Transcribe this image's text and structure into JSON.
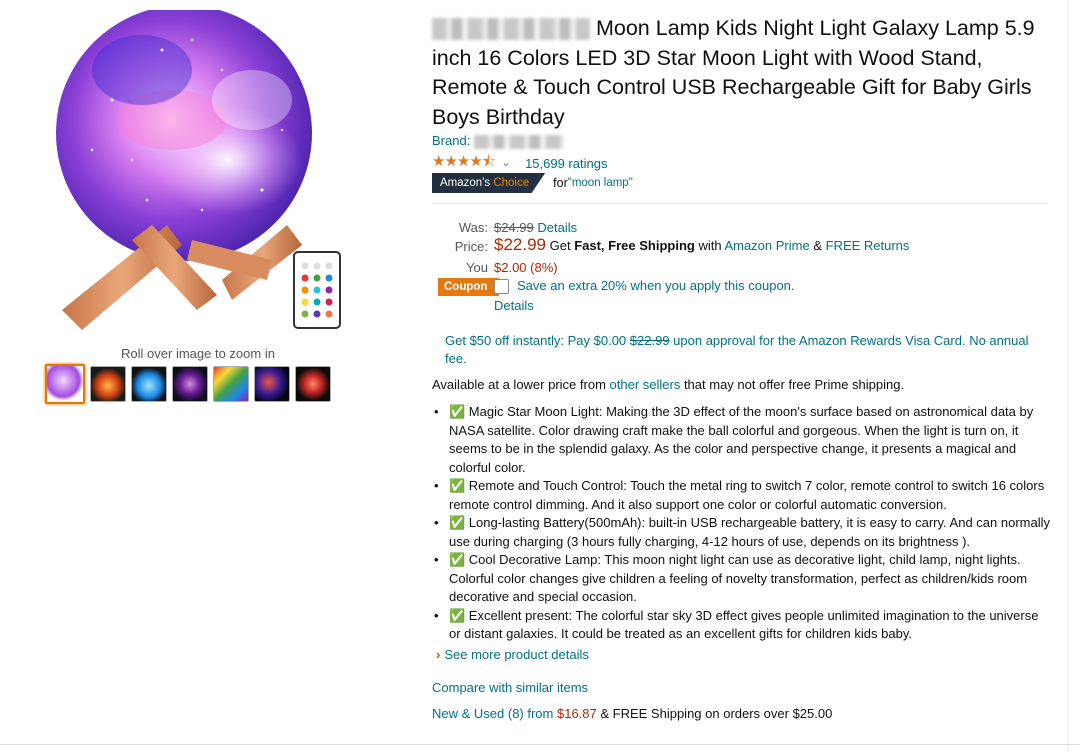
{
  "gallery": {
    "zoom_hint": "Roll over image to zoom in",
    "thumbnails": [
      "moon-lamp-thumb",
      "planets-thumb",
      "moon-blue-thumb",
      "touch-thumb",
      "colors-thumb",
      "galaxy-thumb",
      "lamp-dark-thumb"
    ]
  },
  "title": {
    "text": "Moon Lamp Kids Night Light Galaxy Lamp 5.9 inch 16 Colors LED 3D Star Moon Light with Wood Stand, Remote & Touch Control USB Rechargeable Gift for Baby Girls Boys Birthday"
  },
  "brand": {
    "label": "Brand:"
  },
  "rating": {
    "stars": "★★★★⯪",
    "count": "15,699 ratings",
    "chevron": "⌄"
  },
  "choice": {
    "badge_a": "Amazon's ",
    "badge_b": "Choice",
    "for_text": "for ",
    "keyword": "\"moon lamp\""
  },
  "price": {
    "was_label": "Was:",
    "was_value": "$24.99",
    "was_details": "Details",
    "price_label": "Price:",
    "price_value": "$22.99",
    "price_get": "Get ",
    "shipping_bold": "Fast, Free Shipping",
    "with": " with ",
    "prime_link": "Amazon Prime",
    "amp": " & ",
    "returns_link": "FREE Returns",
    "save_label": "You Save:",
    "save_value": "$2.00 (8%)",
    "coupon_tag": "Coupon",
    "coupon_text": "Save an extra 20% when you apply this coupon.",
    "coupon_details": "Details"
  },
  "visa": {
    "pre": "Get $50 off instantly: Pay $0.00 ",
    "strike": "$22.99",
    "post": " upon approval for the Amazon Rewards Visa Card. No annual fee."
  },
  "availability": {
    "pre": "Available at a lower price from ",
    "link": "other sellers",
    "post": " that may not offer free Prime shipping."
  },
  "bullets": [
    "✅ Magic Star Moon Light: Making the 3D effect of the moon's surface based on astronomical data by NASA satellite. Color drawing craft make the ball colorful and gorgeous. When the light is turn on, it seems to be in the splendid galaxy. As the color and perspective change, it presents a magical and colorful color.",
    "✅ Remote and Touch Control: Touch the metal ring to switch 7 color, remote control to switch 16 colors remote control dimming. And it also support one color or colorful automatic conversion.",
    "✅ Long-lasting Battery(500mAh): built-in USB rechargeable battery, it is easy to carry. And can normally use during charging (3 hours fully charging, 4-12 hours of use, depends on its brightness ).",
    "✅ Cool Decorative Lamp: This moon night light can use as decorative light, child lamp, night lights. Colorful color changes give children a feeling of novelty transformation, perfect as children/kids room decorative and special occasion.",
    "✅ Excellent present: The colorful star sky 3D effect gives people unlimited imagination to the universe or distant galaxies. It could be treated as an excellent gifts for children kids baby."
  ],
  "see_more": {
    "chev": "›",
    "text": "See more product details"
  },
  "compare": "Compare with similar items",
  "new_used": {
    "link": "New & Used (8) from ",
    "price": "$16.87",
    "post": " & FREE Shipping on orders over $25.00"
  }
}
